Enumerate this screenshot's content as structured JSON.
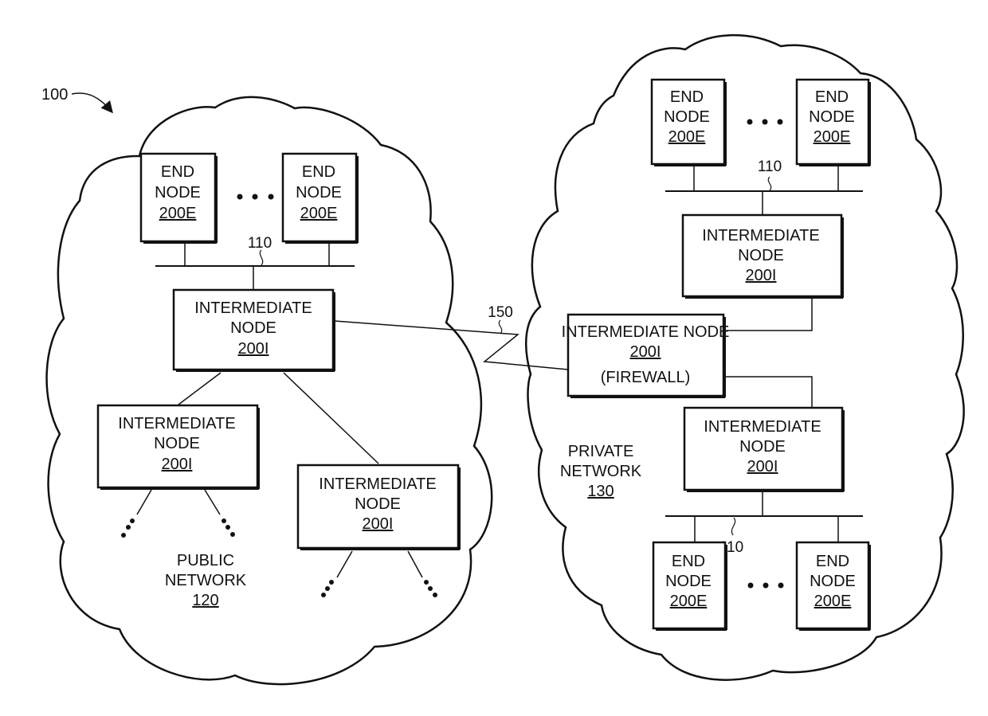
{
  "figure": {
    "ref_label": "100",
    "colors": {
      "ink": "#111111",
      "background": "#ffffff"
    }
  },
  "public_network": {
    "name_line1": "PUBLIC",
    "name_line2": "NETWORK",
    "ref": "120",
    "end_nodes": [
      {
        "line1": "END",
        "line2": "NODE",
        "ref": "200E"
      },
      {
        "line1": "END",
        "line2": "NODE",
        "ref": "200E"
      }
    ],
    "lan_ref": "110",
    "intermediate_nodes": [
      {
        "line1": "INTERMEDIATE",
        "line2": "NODE",
        "ref": "200I"
      },
      {
        "line1": "INTERMEDIATE",
        "line2": "NODE",
        "ref": "200I"
      },
      {
        "line1": "INTERMEDIATE",
        "line2": "NODE",
        "ref": "200I"
      }
    ]
  },
  "link": {
    "ref": "150"
  },
  "private_network": {
    "name_line1": "PRIVATE",
    "name_line2": "NETWORK",
    "ref": "130",
    "top_end_nodes": [
      {
        "line1": "END",
        "line2": "NODE",
        "ref": "200E"
      },
      {
        "line1": "END",
        "line2": "NODE",
        "ref": "200E"
      }
    ],
    "bottom_end_nodes": [
      {
        "line1": "END",
        "line2": "NODE",
        "ref": "200E"
      },
      {
        "line1": "END",
        "line2": "NODE",
        "ref": "200E"
      }
    ],
    "lan_refs": [
      "110",
      "110"
    ],
    "intermediate_nodes": [
      {
        "line1": "INTERMEDIATE",
        "line2": "NODE",
        "ref": "200I"
      },
      {
        "line1": "INTERMEDIATE",
        "line2": "NODE",
        "ref": "200I"
      }
    ],
    "firewall": {
      "line1": "INTERMEDIATE NODE",
      "ref": "200I",
      "note": "(FIREWALL)"
    }
  }
}
